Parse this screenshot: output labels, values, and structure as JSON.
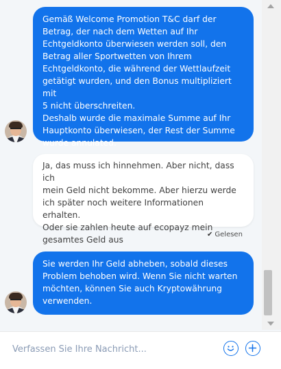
{
  "messages": [
    {
      "sender": "agent",
      "text": "Gemäß Welcome Promotion T&C darf der\nBetrag, der nach dem Wetten auf Ihr\nEchtgeldkonto überwiesen werden soll, den\nBetrag aller Sportwetten von Ihrem\nEchtgeldkonto, die während der Wettlaufzeit\ngetätigt wurden, und den Bonus multipliziert mit\n5 nicht überschreiten.\nDeshalb wurde die maximale Summe auf Ihr\nHauptkonto überwiesen, der Rest der Summe\nwurde annulated."
    },
    {
      "sender": "user",
      "text": "Ja, das muss ich hinnehmen. Aber nicht, dass ich\nmein Geld nicht bekomme. Aber hierzu werde\nich später noch weitere Informationen erhalten.\nOder sie zahlen heute auf ecopayz mein\ngesamtes Geld aus"
    },
    {
      "sender": "agent",
      "text": "Sie werden Ihr Geld abheben, sobald dieses\nProblem behoben wird. Wenn Sie nicht warten\nmöchten, können Sie auch Kryptowährung\nverwenden."
    }
  ],
  "read_status": "Gelesen",
  "composer": {
    "placeholder": "Verfassen Sie Ihre Nachricht..."
  },
  "icons": {
    "emoji": "smiley-icon",
    "attach": "plus-icon",
    "read": "checkmark-icon"
  },
  "colors": {
    "agent_bubble": "#1273eb",
    "user_bubble": "#ffffff",
    "background": "#f3f6f9",
    "placeholder": "#8a9bb5"
  }
}
